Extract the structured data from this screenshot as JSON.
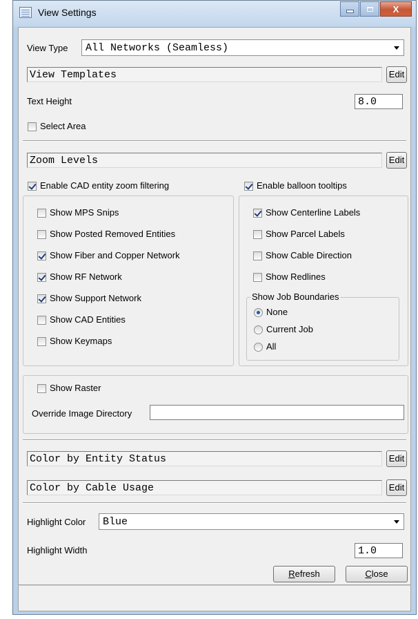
{
  "window": {
    "title": "View Settings",
    "icon": "table-window-icon",
    "buttons": {
      "minimize_icon": "minimize-icon",
      "maximize_icon": "maximize-icon",
      "close_glyph": "X"
    }
  },
  "view_type": {
    "label": "View Type",
    "value": "All Networks (Seamless)"
  },
  "view_templates": {
    "value": "View Templates",
    "edit_label": "Edit"
  },
  "text_height": {
    "label": "Text Height",
    "value": "8.0"
  },
  "select_area": {
    "label": "Select Area",
    "checked": false
  },
  "zoom_levels": {
    "value": "Zoom Levels",
    "edit_label": "Edit"
  },
  "enable_cad_zoom": {
    "label": "Enable CAD entity zoom filtering",
    "checked": true
  },
  "enable_balloon": {
    "label": "Enable balloon tooltips",
    "checked": true
  },
  "left_options": [
    {
      "label": "Show MPS Snips",
      "checked": false
    },
    {
      "label": "Show Posted Removed Entities",
      "checked": false
    },
    {
      "label": "Show Fiber and Copper Network",
      "checked": true
    },
    {
      "label": "Show RF Network",
      "checked": true
    },
    {
      "label": "Show Support Network",
      "checked": true
    },
    {
      "label": "Show CAD Entities",
      "checked": false
    },
    {
      "label": "Show Keymaps",
      "checked": false
    }
  ],
  "right_options": [
    {
      "label": "Show Centerline Labels",
      "checked": true
    },
    {
      "label": "Show Parcel Labels",
      "checked": false
    },
    {
      "label": "Show Cable Direction",
      "checked": false
    },
    {
      "label": "Show Redlines",
      "checked": false
    }
  ],
  "job_boundaries": {
    "title": "Show Job Boundaries",
    "options": [
      {
        "label": "None",
        "selected": true
      },
      {
        "label": "Current Job",
        "selected": false
      },
      {
        "label": "All",
        "selected": false
      }
    ]
  },
  "raster": {
    "show_label": "Show Raster",
    "checked": false,
    "override_label": "Override Image Directory",
    "override_value": ""
  },
  "color_entity_status": {
    "value": "Color by Entity Status",
    "edit_label": "Edit"
  },
  "color_cable_usage": {
    "value": "Color by Cable Usage",
    "edit_label": "Edit"
  },
  "highlight_color": {
    "label": "Highlight Color",
    "value": "Blue"
  },
  "highlight_width": {
    "label": "Highlight Width",
    "value": "1.0"
  },
  "buttons": {
    "refresh_label": "Refresh",
    "refresh_key": "R",
    "refresh_rest": "efresh",
    "close_label": "Close",
    "close_key": "C",
    "close_rest": "lose"
  }
}
